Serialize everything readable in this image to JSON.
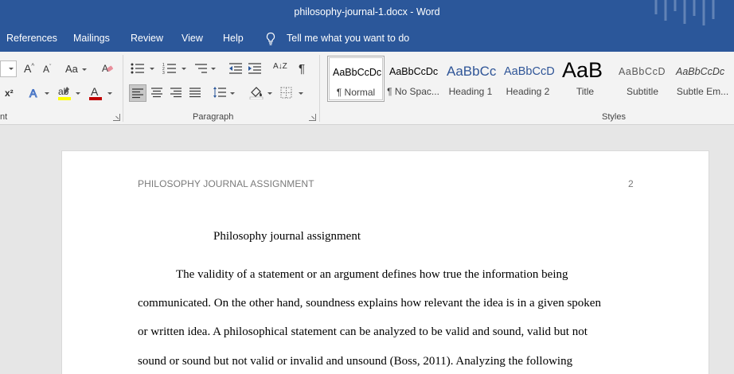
{
  "window": {
    "title": "philosophy-journal-1.docx  -  Word"
  },
  "menu": {
    "references": "References",
    "mailings": "Mailings",
    "review": "Review",
    "view": "View",
    "help": "Help",
    "tell_me": "Tell me what you want to do"
  },
  "ribbon": {
    "font_group_label": "nt",
    "paragraph_group_label": "Paragraph",
    "styles_group_label": "Styles",
    "change_case": "Aa",
    "superscript": "x²",
    "sort": "A↓Z",
    "pilcrow": "¶",
    "styles": [
      {
        "sample": "AaBbCcDc",
        "name": "¶ Normal"
      },
      {
        "sample": "AaBbCcDc",
        "name": "¶ No Spac..."
      },
      {
        "sample": "AaBbCc",
        "name": "Heading 1"
      },
      {
        "sample": "AaBbCcD",
        "name": "Heading 2"
      },
      {
        "sample": "AaB",
        "name": "Title"
      },
      {
        "sample": "AaBbCcD",
        "name": "Subtitle"
      },
      {
        "sample": "AaBbCcDc",
        "name": "Subtle Em..."
      }
    ],
    "colors": {
      "highlight": "#ffff00",
      "font_color": "#c00000",
      "accent": "#2b579a"
    }
  },
  "document": {
    "header": "PHILOSOPHY JOURNAL ASSIGNMENT",
    "page_number": "2",
    "title": "Philosophy journal assignment",
    "lines": [
      "The validity of a statement or an argument defines how true the information being",
      "communicated. On the other hand, soundness explains how relevant the idea is in a given spoken",
      "or written idea. A philosophical statement can be analyzed to be valid and sound, valid but not",
      "sound or sound but not valid or invalid and unsound (Boss, 2011). Analyzing the following"
    ]
  }
}
